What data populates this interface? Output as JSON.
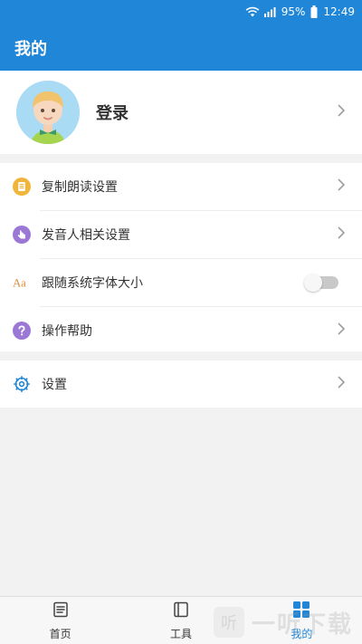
{
  "status_bar": {
    "battery_percent": "95%",
    "time": "12:49"
  },
  "header": {
    "title": "我的"
  },
  "profile": {
    "login_label": "登录"
  },
  "menu": {
    "items": [
      {
        "label": "复制朗读设置",
        "icon": "document-icon"
      },
      {
        "label": "发音人相关设置",
        "icon": "hand-touch-icon"
      },
      {
        "label": "跟随系统字体大小",
        "icon": "aa-text-icon",
        "toggle_on": false
      },
      {
        "label": "操作帮助",
        "icon": "help-icon"
      }
    ]
  },
  "menu2": {
    "items": [
      {
        "label": "设置",
        "icon": "gear-icon"
      }
    ]
  },
  "bottom_nav": {
    "items": [
      {
        "label": "首页",
        "icon": "home-doc-icon",
        "active": false
      },
      {
        "label": "工具",
        "icon": "book-icon",
        "active": false
      },
      {
        "label": "我的",
        "icon": "grid-icon",
        "active": true
      }
    ]
  },
  "watermark": {
    "text": "一听下载",
    "badge": "听"
  },
  "icons": {
    "wifi": "wifi-icon",
    "signal": "signal-icon",
    "battery": "battery-icon",
    "chevron": "chevron-right-icon"
  },
  "colors": {
    "primary": "#1f86d8",
    "toggle_off": "#c9c9c9"
  }
}
